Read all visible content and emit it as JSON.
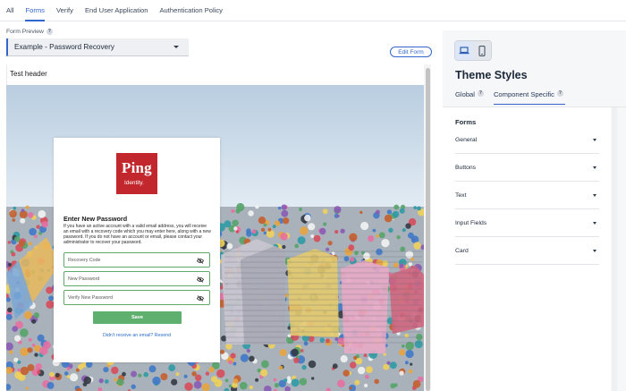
{
  "top_tabs": [
    {
      "label": "All",
      "active": false
    },
    {
      "label": "Forms",
      "active": true
    },
    {
      "label": "Verify",
      "active": false
    },
    {
      "label": "End User Application",
      "active": false
    },
    {
      "label": "Authentication Policy",
      "active": false
    }
  ],
  "form_preview": {
    "label": "Form Preview",
    "help": "?",
    "selected": "Example - Password Recovery",
    "edit_button": "Edit Form"
  },
  "preview": {
    "header_text": "Test header",
    "logo": {
      "word": "Ping",
      "sub": "Identity."
    },
    "card": {
      "title": "Enter New Password",
      "description": "If you have an active account with a valid email address, you will receive an email with a recovery code which you may enter here, along with a new password. If you do not have an account or email, please contact your administrator to recover your password.",
      "fields": [
        {
          "placeholder": "Recovery Code"
        },
        {
          "placeholder": "New Password"
        },
        {
          "placeholder": "Verify New Password"
        }
      ],
      "save_label": "Save",
      "resend_text": "Didn't receive an email? Resend"
    }
  },
  "theme_panel": {
    "title": "Theme Styles",
    "devices": [
      {
        "name": "laptop-icon",
        "active": true
      },
      {
        "name": "phone-icon",
        "active": false
      }
    ],
    "tabs": [
      {
        "label": "Global",
        "help": "?",
        "active": false
      },
      {
        "label": "Component Specific",
        "help": "?",
        "active": true
      }
    ],
    "forms_heading": "Forms",
    "sections": [
      {
        "label": "General"
      },
      {
        "label": "Buttons"
      },
      {
        "label": "Text"
      },
      {
        "label": "Input Fields"
      },
      {
        "label": "Card"
      }
    ]
  },
  "colors": {
    "accent": "#3366cc",
    "brand_red": "#c1272d",
    "save_green": "#5faf6e",
    "field_border": "#5faa6a",
    "link_blue": "#2b6ec6"
  }
}
